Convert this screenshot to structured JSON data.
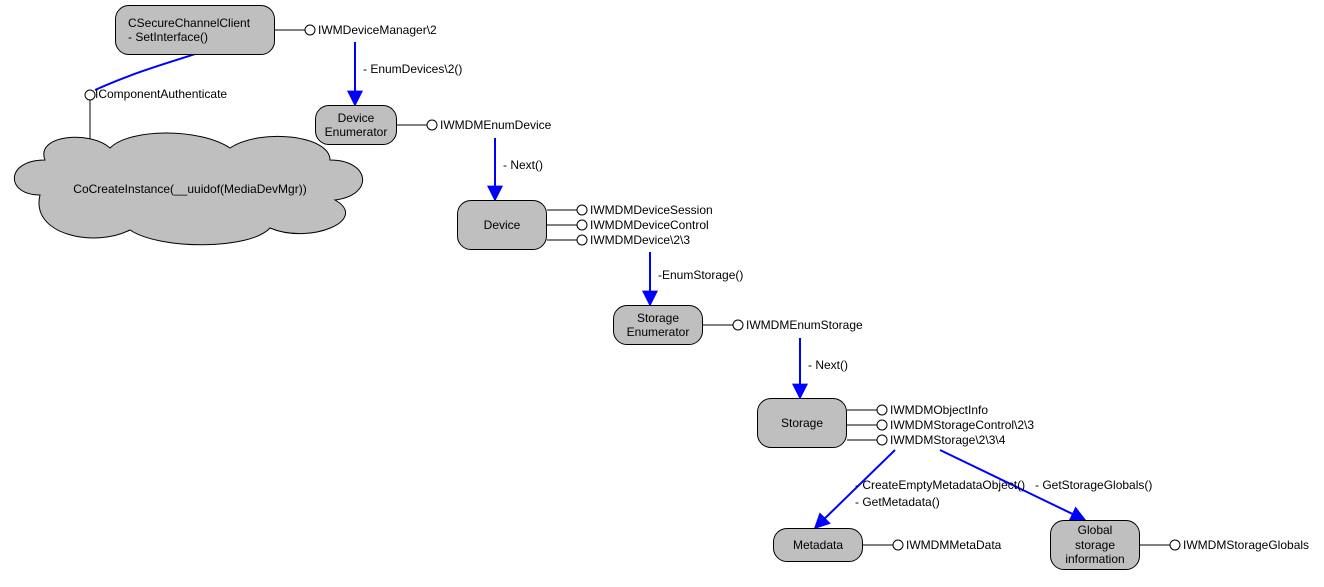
{
  "nodes": {
    "secure": {
      "text": "CSecureChannelClient\n- SetInterface()"
    },
    "cloud": {
      "text": "CoCreateInstance(__uuidof(MediaDevMgr))"
    },
    "deviceEnum": {
      "text": "Device\nEnumerator"
    },
    "device": {
      "text": "Device"
    },
    "storageEnum": {
      "text": "Storage\nEnumerator"
    },
    "storage": {
      "text": "Storage"
    },
    "metadata": {
      "text": "Metadata"
    },
    "global": {
      "text": "Global\nstorage\ninformation"
    }
  },
  "interfaces": {
    "iwmdevicemgr": "IWMDeviceManager\\2",
    "icompauth": "IComponentAuthenticate",
    "iwmdmenumdevice": "IWMDMEnumDevice",
    "iwmdmdevicesession": "IWMDMDeviceSession",
    "iwmdmdevicecontrol": "IWMDMDeviceControl",
    "iwmdmdevice23": "IWMDMDevice\\2\\3",
    "iwmdmenumstorage": "IWMDMEnumStorage",
    "iwmdmobjectinfo": "IWMDMObjectInfo",
    "iwmdmstoragecontrol": "IWMDMStorageControl\\2\\3",
    "iwmdmstorage234": "IWMDMStorage\\2\\3\\4",
    "iwmdmmetadata": "IWMDMMetaData",
    "iwmdmstorageglobals": "IWMDMStorageGlobals"
  },
  "methods": {
    "enumdevices": "- EnumDevices\\2()",
    "next1": "- Next()",
    "enumstorage": "-EnumStorage()",
    "next2": "- Next()",
    "createempty": "- CreateEmptyMetadataObject()",
    "getmetadata": "- GetMetadata()",
    "getstorageglobals": "- GetStorageGlobals()"
  }
}
